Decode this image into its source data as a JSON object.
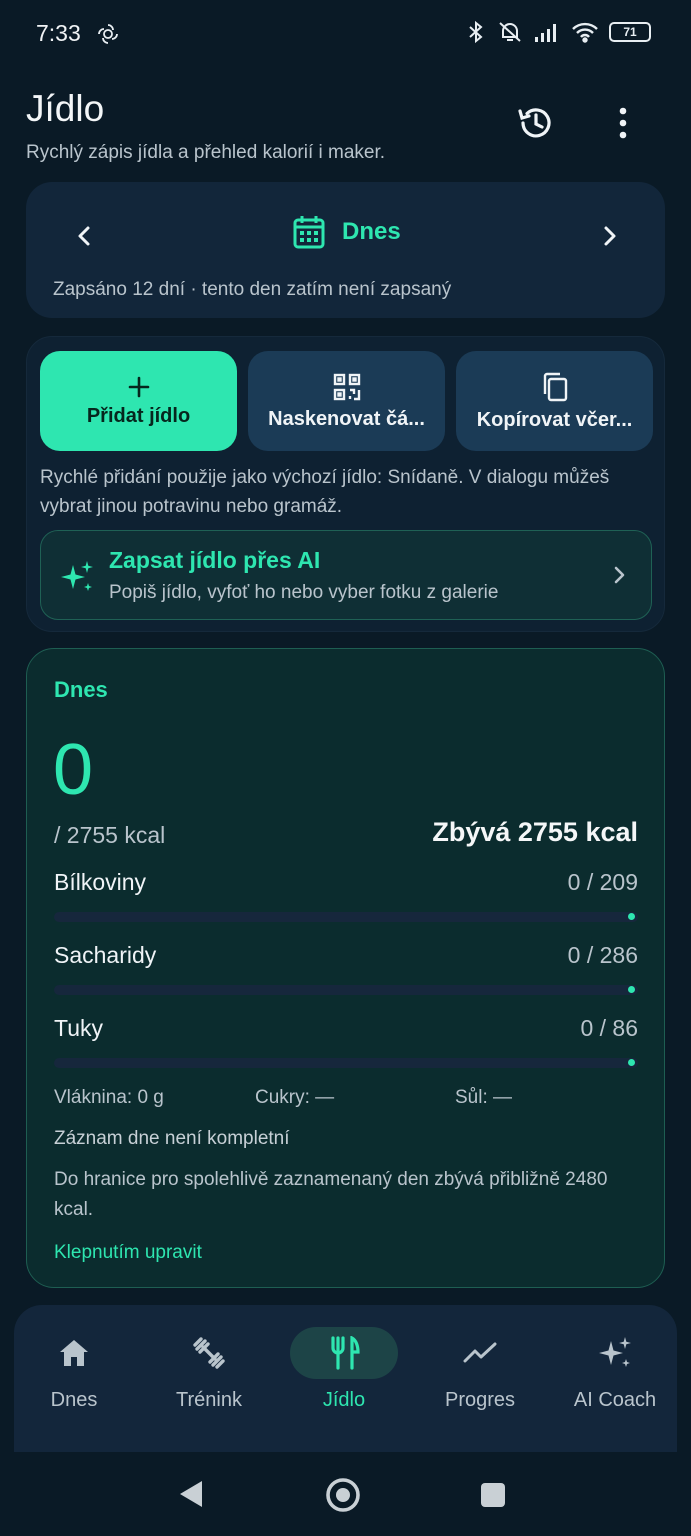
{
  "status_bar": {
    "time": "7:33",
    "battery": "71"
  },
  "header": {
    "title": "Jídlo",
    "subtitle": "Rychlý zápis jídla a přehled kalorií i maker."
  },
  "date_nav": {
    "label": "Dnes",
    "logged_info": "Zapsáno 12 dní · tento den zatím není zapsaný"
  },
  "quick_actions": {
    "add_label": "Přidat jídlo",
    "scan_label": "Naskenovat čá...",
    "copy_label": "Kopírovat včer...",
    "hint": "Rychlé přidání použije jako výchozí jídlo: Snídaně. V dialogu můžeš vybrat jinou potravinu nebo gramáž.",
    "ai_title": "Zapsat jídlo přes AI",
    "ai_subtitle": "Popiš jídlo, vyfoť ho nebo vyber fotku z galerie"
  },
  "summary": {
    "day_label": "Dnes",
    "calories_eaten": "0",
    "calories_goal": "/ 2755 kcal",
    "remaining": "Zbývá 2755 kcal",
    "macros": [
      {
        "name": "Bílkoviny",
        "value": "0 / 209",
        "progress": 0
      },
      {
        "name": "Sacharidy",
        "value": "0 / 286",
        "progress": 0
      },
      {
        "name": "Tuky",
        "value": "0 / 86",
        "progress": 0
      }
    ],
    "fiber": "Vláknina: 0 g",
    "sugar": "Cukry: —",
    "salt": "Sůl: —",
    "status_note": "Záznam dne není kompletní",
    "description": "Do hranice pro spolehlivě zaznamenaný den zbývá přibližně 2480 kcal.",
    "edit_link": "Klepnutím upravit"
  },
  "bottom_nav": {
    "items": [
      {
        "label": "Dnes",
        "icon": "home-icon"
      },
      {
        "label": "Trénink",
        "icon": "dumbbell-icon"
      },
      {
        "label": "Jídlo",
        "icon": "fork-knife-icon"
      },
      {
        "label": "Progres",
        "icon": "trend-icon"
      },
      {
        "label": "AI Coach",
        "icon": "sparkle-icon"
      }
    ],
    "active_index": 2
  },
  "colors": {
    "accent": "#2ee6b0",
    "background": "#0a1a26",
    "card": "#12263a"
  }
}
